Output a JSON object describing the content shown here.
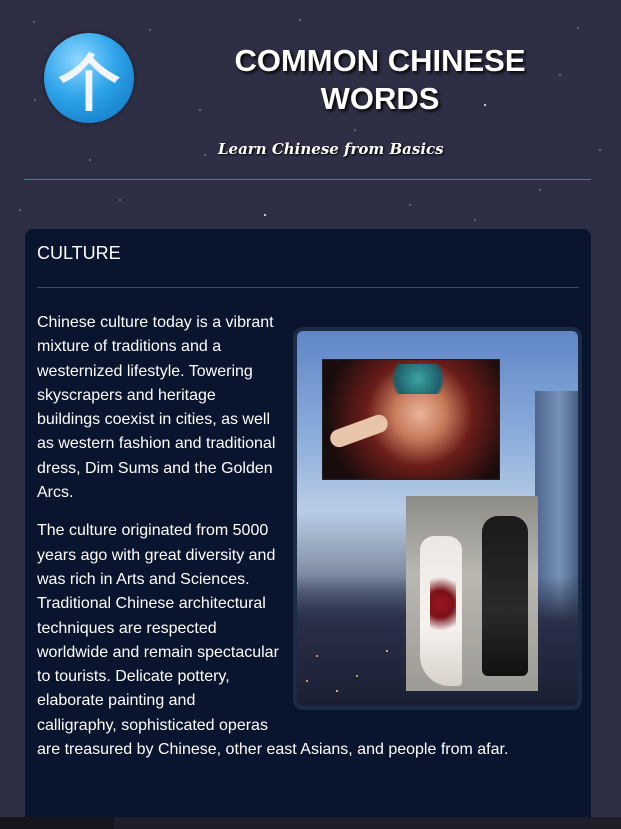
{
  "header": {
    "logo_char": "个",
    "title": "COMMON CHINESE WORDS",
    "tagline": "Learn Chinese from Basics"
  },
  "section": {
    "title": "CULTURE",
    "paragraph_1": "Chinese culture today is a vibrant mixture of traditions and a westernized lifestyle. Towering skyscrapers and heritage buildings coexist in cities, as well as western fashion and traditional dress, Dim Sums and the Golden Arcs.",
    "paragraph_2": "The culture originated from 5000 years ago with great diversity and was rich in Arts and Sciences. Traditional Chinese architectural techniques are respected worldwide and remain spectacular to tourists. Delicate pottery, elaborate painting and calligraphy, sophisticated operas are treasured by Chinese, other east Asians, and people from afar."
  }
}
